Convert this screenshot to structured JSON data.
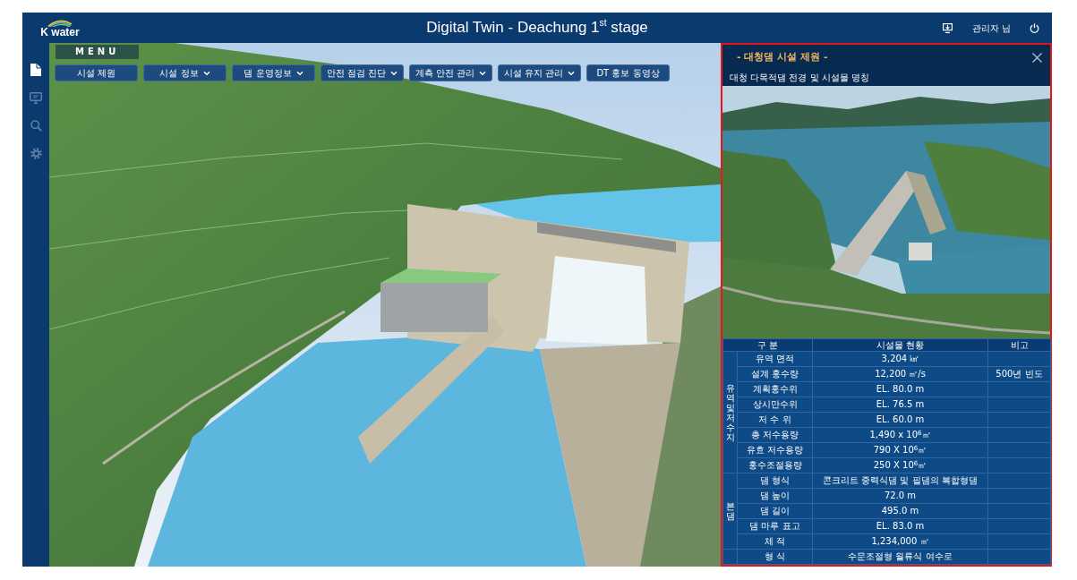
{
  "header": {
    "logo_text": "K water",
    "title": "Digital Twin - Deachung 1$^{st}$ stage",
    "user": "관리자 님"
  },
  "sidebar": {
    "items": [
      {
        "selected": true
      },
      {
        "selected": false
      },
      {
        "selected": false
      },
      {
        "selected": false
      }
    ]
  },
  "menu": {
    "label": "MENU",
    "buttons": [
      {
        "label": "시설 제원",
        "kind": "plain"
      },
      {
        "label": "시설 정보",
        "kind": "dropdown"
      },
      {
        "label": "댐 운영정보",
        "kind": "dropdown"
      },
      {
        "label": "안전 점검 진단",
        "kind": "dropdown"
      },
      {
        "label": "계측 안전 관리",
        "kind": "dropdown"
      },
      {
        "label": "시설 유지 관리",
        "kind": "dropdown"
      },
      {
        "label": "DT 홍보 동영상",
        "kind": "plain"
      }
    ]
  },
  "panel": {
    "title": "- 대청댐 시설 제원 -",
    "subtitle": "대청 다목적댐 전경 및 시설물 명칭",
    "table": {
      "columns": [
        "구 분",
        "시설물 현황",
        "비고"
      ],
      "groups": [
        {
          "label": "유역및저수지",
          "rows": [
            {
              "item": "유역 면적",
              "value": "3,204 ㎢"
            },
            {
              "item": "설계 홍수량",
              "value": "12,200 ㎥/s",
              "note": "500년 빈도"
            },
            {
              "item": "계획홍수위",
              "value": "EL. 80.0 m"
            },
            {
              "item": "상시만수위",
              "value": "EL. 76.5 m"
            },
            {
              "item": "저 수 위",
              "value": "EL. 60.0 m"
            },
            {
              "item": "총 저수용량",
              "value": "1,490 x 10$^{6}$㎥"
            },
            {
              "item": "유효 저수용량",
              "value": "790 X 10$^{6}$㎥"
            },
            {
              "item": "홍수조절용량",
              "value": "250 X 10$^{6}$㎥"
            }
          ]
        },
        {
          "label": "본댐",
          "rows": [
            {
              "item": "댐 형식",
              "value": "콘크리트 중력식댐 및 필댐의 복합형댐"
            },
            {
              "item": "댐 높이",
              "value": "72.0 m"
            },
            {
              "item": "댐 길이",
              "value": "495.0 m"
            },
            {
              "item": "댐 마루 표고",
              "value": "EL. 83.0 m"
            },
            {
              "item": "체 적",
              "value": "1,234,000 ㎥"
            }
          ]
        },
        {
          "rows": [
            {
              "item": "형 식",
              "value": "수문조절형 월류식 여수로"
            }
          ]
        }
      ]
    }
  }
}
